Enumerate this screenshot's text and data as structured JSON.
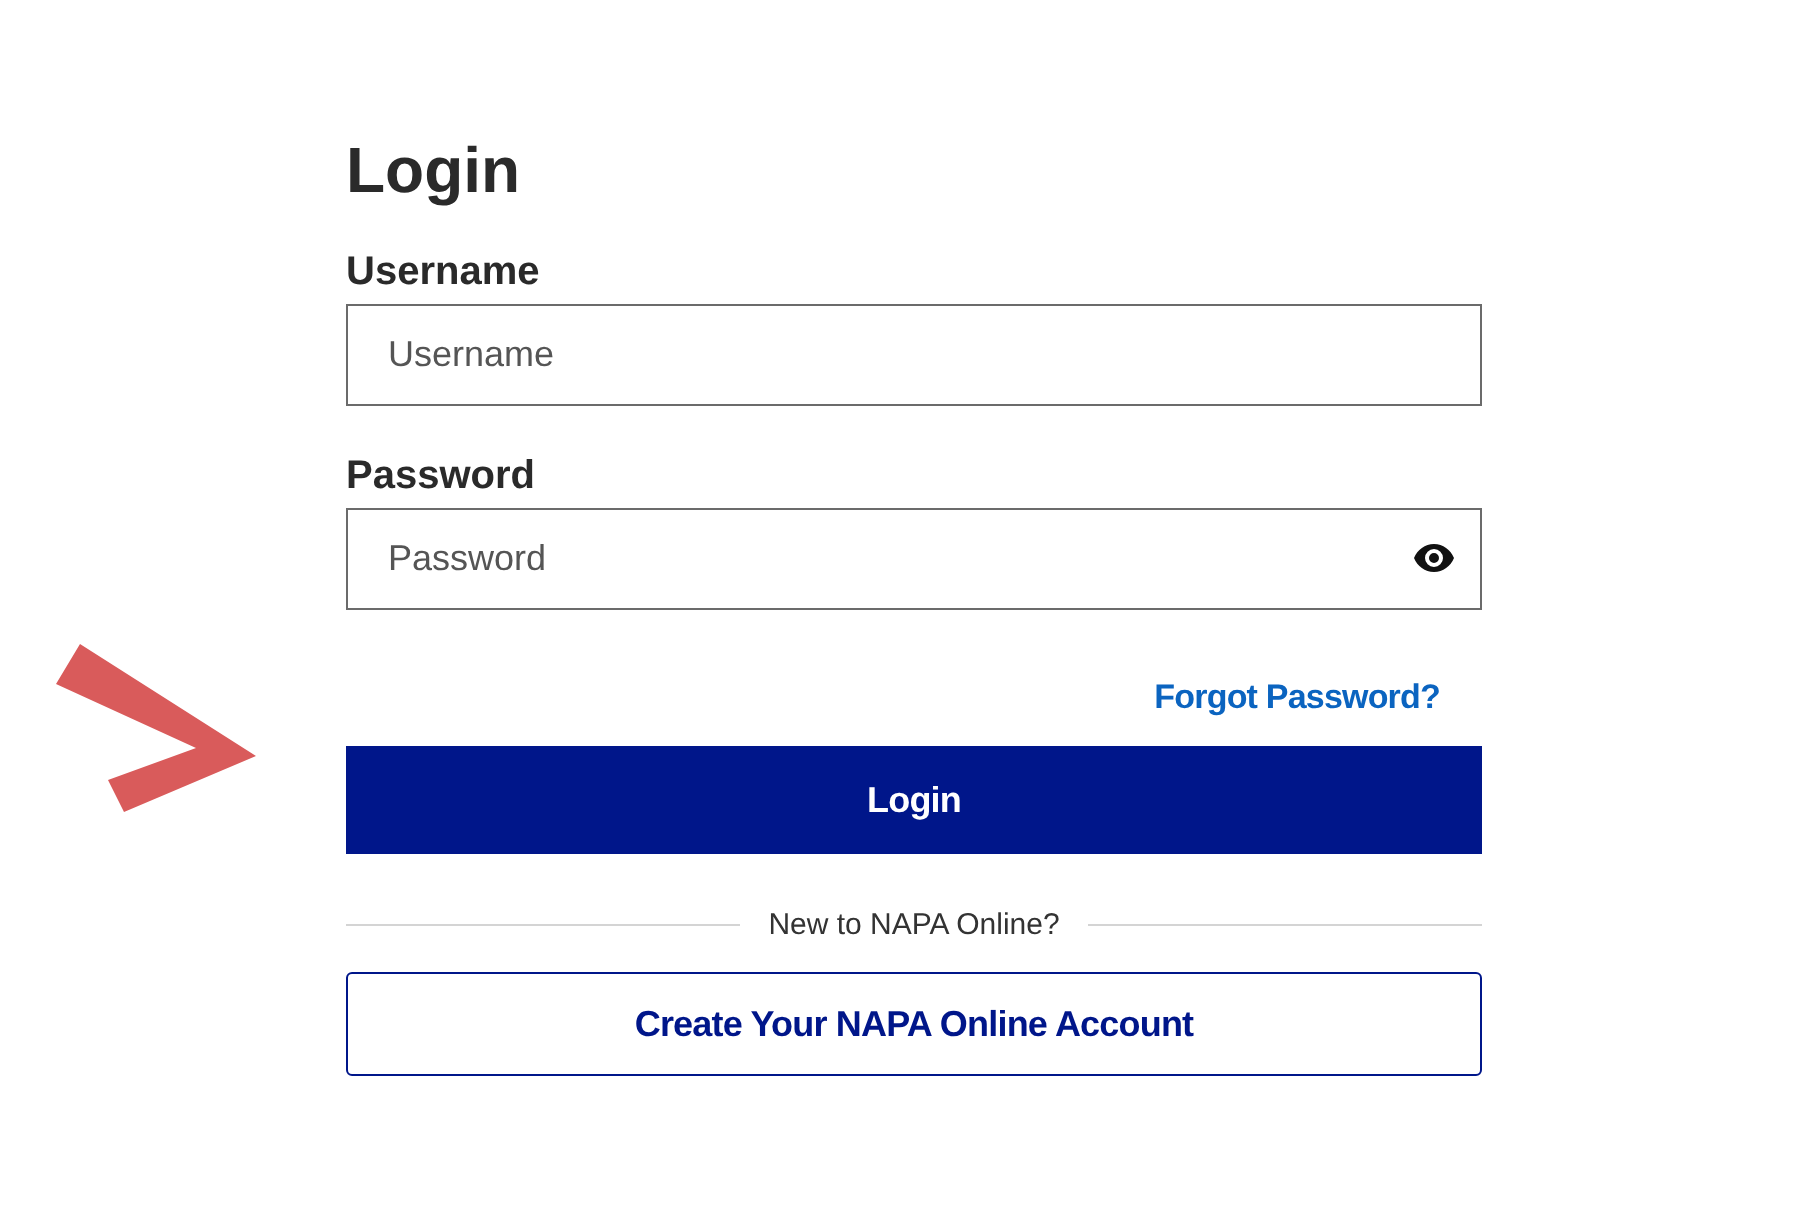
{
  "title": "Login",
  "fields": [
    {
      "label": "Username",
      "placeholder": "Username",
      "kind": "text"
    },
    {
      "label": "Password",
      "placeholder": "Password",
      "kind": "password"
    }
  ],
  "forgot_link": "Forgot Password?",
  "login_button": "Login",
  "divider_text": "New to NAPA Online?",
  "create_button": "Create Your NAPA Online Account"
}
